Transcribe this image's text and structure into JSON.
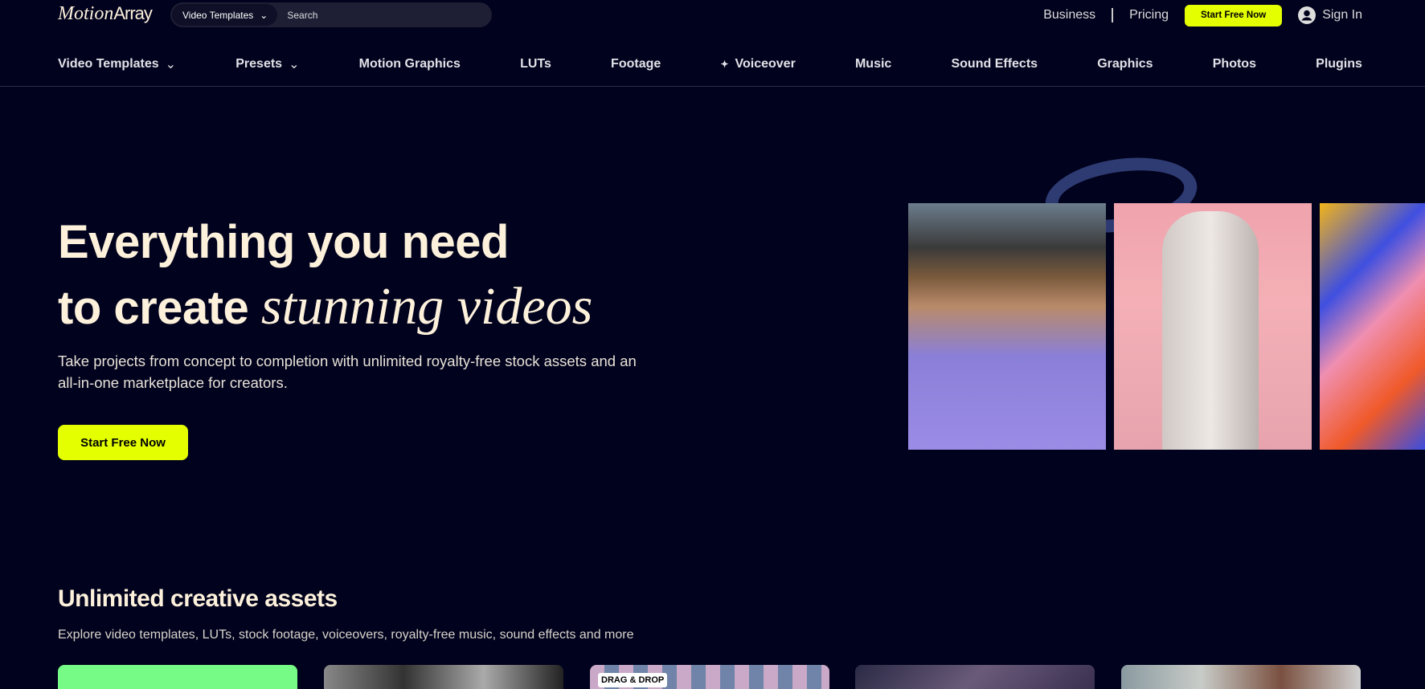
{
  "header": {
    "logo": {
      "part1": "Motion",
      "part2": "Array"
    },
    "search": {
      "category": "Video Templates",
      "placeholder": "Search"
    },
    "links": {
      "business": "Business",
      "pricing": "Pricing",
      "start": "Start Free Now",
      "signin": "Sign In"
    }
  },
  "nav": {
    "items": [
      "Video Templates",
      "Presets",
      "Motion Graphics",
      "LUTs",
      "Footage",
      "Voiceover",
      "Music",
      "Sound Effects",
      "Graphics",
      "Photos",
      "Plugins"
    ]
  },
  "hero": {
    "line1": "Everything you need",
    "line2_plain": "to create ",
    "line2_italic": "stunning videos",
    "lead": "Take projects from concept to completion with unlimited royalty-free stock assets and an all-in-one marketplace for creators.",
    "cta": "Start Free Now"
  },
  "assets": {
    "title": "Unlimited creative assets",
    "subtitle": "Explore video templates, LUTs, stock footage, voiceovers, royalty-free music, sound effects and more",
    "card3_badge": "DRAG & DROP"
  },
  "colors": {
    "bg": "#01021d",
    "accent": "#e3ff00",
    "cream": "#fdf1dc"
  }
}
